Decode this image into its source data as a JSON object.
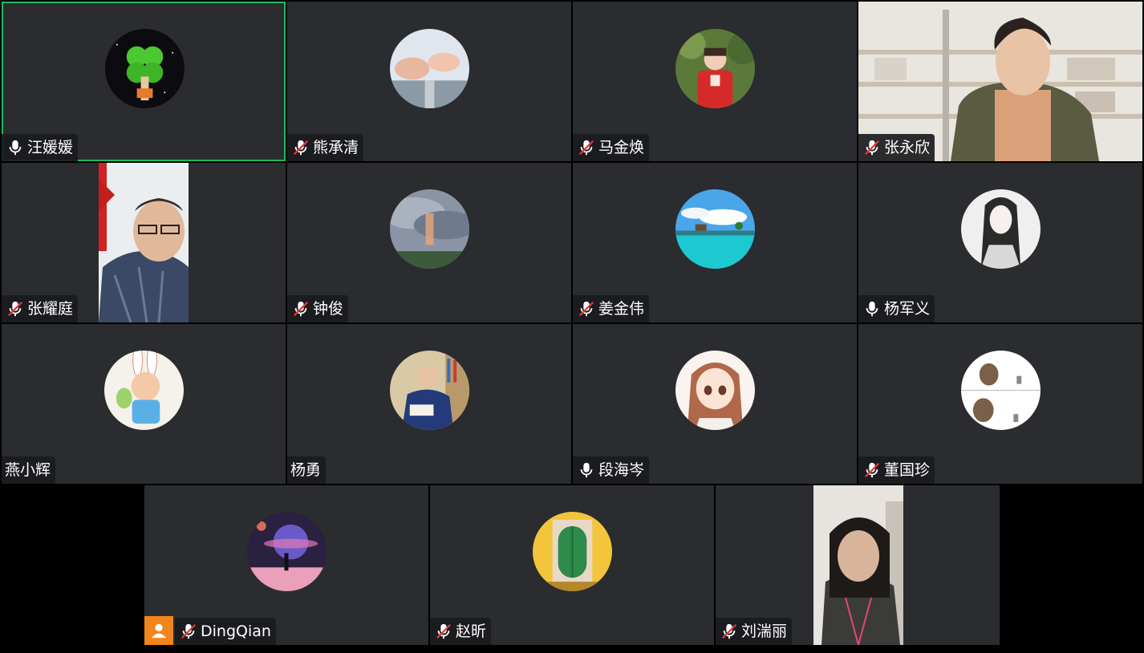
{
  "participants": [
    {
      "name": "汪媛媛",
      "mic": "on",
      "active": true
    },
    {
      "name": "熊承清",
      "mic": "muted"
    },
    {
      "name": "马金焕",
      "mic": "muted"
    },
    {
      "name": "张永欣",
      "mic": "muted"
    },
    {
      "name": "张耀庭",
      "mic": "muted"
    },
    {
      "name": "钟俊",
      "mic": "muted"
    },
    {
      "name": "姜金伟",
      "mic": "muted"
    },
    {
      "name": "杨军义",
      "mic": "on"
    },
    {
      "name": "燕小辉",
      "mic": "none"
    },
    {
      "name": "杨勇",
      "mic": "none"
    },
    {
      "name": "段海岑",
      "mic": "on"
    },
    {
      "name": "董国珍",
      "mic": "muted"
    },
    {
      "name": "DingQian",
      "mic": "muted"
    },
    {
      "name": "赵昕",
      "mic": "muted"
    },
    {
      "name": "刘湍丽",
      "mic": "muted"
    }
  ],
  "colors": {
    "tile_bg": "#2a2c30",
    "active_border": "#1fb95a",
    "label_bg": "#1a1b1e",
    "muted_red": "#e03a3a",
    "user_badge": "#f2851b"
  },
  "icons": {
    "mic_on": "microphone-icon",
    "mic_muted": "microphone-muted-icon",
    "user": "user-icon"
  }
}
